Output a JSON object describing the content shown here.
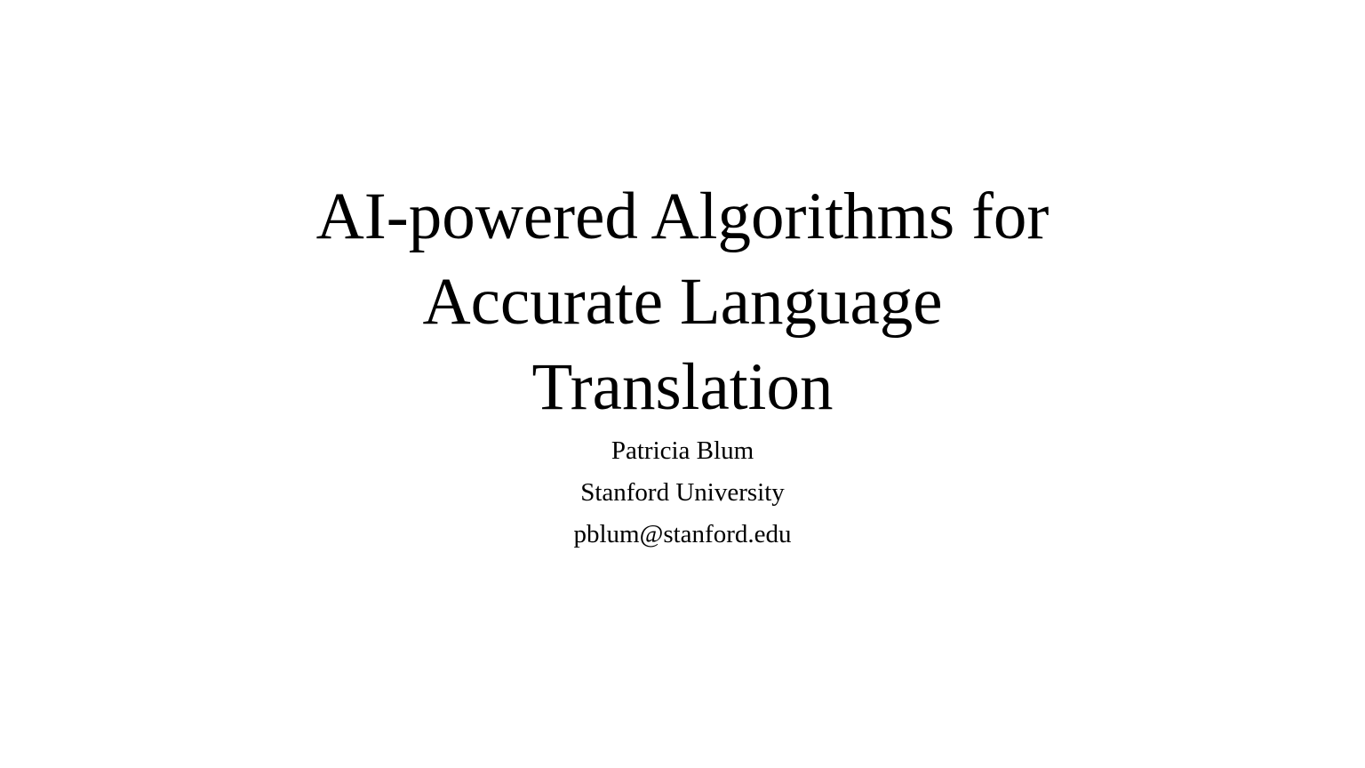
{
  "slide": {
    "title_lines": [
      "AI-powered Algorithms for",
      "Accurate Language",
      "Translation"
    ],
    "author": "Patricia Blum",
    "affiliation": "Stanford University",
    "email": "pblum@stanford.edu"
  },
  "colors": {
    "background": "#ffffff",
    "text": "#000000"
  }
}
